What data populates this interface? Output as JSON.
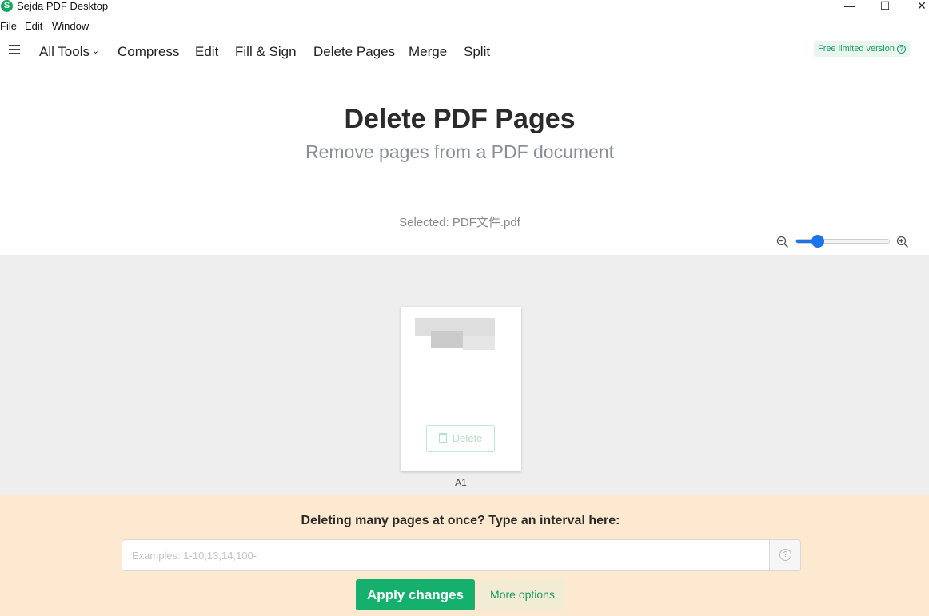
{
  "window": {
    "title": "Sejda PDF Desktop",
    "logo_letter": "S",
    "controls": {
      "minimize": "—",
      "maximize": "☐",
      "close": "✕"
    }
  },
  "menubar": {
    "items": [
      "File",
      "Edit",
      "Window"
    ]
  },
  "toolbar": {
    "nav": [
      "All Tools",
      "Compress",
      "Edit",
      "Fill & Sign",
      "Delete Pages",
      "Merge",
      "Split"
    ],
    "all_tools_chevron": "⌄",
    "free_badge": "Free limited version",
    "free_badge_icon": "?"
  },
  "header": {
    "title": "Delete PDF Pages",
    "subtitle": "Remove pages from a PDF document",
    "selected_file": "Selected: PDF文件.pdf"
  },
  "zoom": {
    "level": 0.2
  },
  "pages": [
    {
      "label": "A1",
      "delete_label": "Delete"
    }
  ],
  "interval": {
    "heading": "Deleting many pages at once? Type an interval here:",
    "placeholder": "Examples: 1-10,13,14,100-",
    "value": "",
    "help_icon": "?"
  },
  "actions": {
    "apply": "Apply changes",
    "more": "More options"
  },
  "colors": {
    "accent_green": "#15b06d",
    "zoom_blue": "#1a73e8",
    "bottom_panel": "#fde9cf",
    "pages_area": "#eeeeee"
  }
}
